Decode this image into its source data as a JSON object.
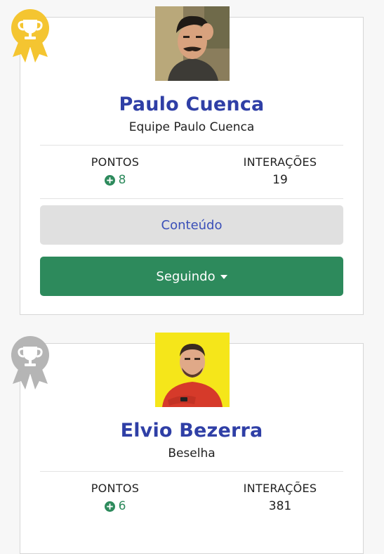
{
  "colors": {
    "name_blue": "#2f3fa6",
    "green": "#2d8a5c",
    "gold_badge": "#f4c531",
    "silver_badge": "#b5b5b5",
    "content_button_bg": "#e0e0e0"
  },
  "cards": [
    {
      "rank_badge": "gold-trophy-icon",
      "name": "Paulo Cuenca",
      "team": "Equipe Paulo Cuenca",
      "points_label": "PONTOS",
      "points_value": "8",
      "interactions_label": "INTERAÇÕES",
      "interactions_value": "19",
      "content_button": "Conteúdo",
      "follow_button": "Seguindo"
    },
    {
      "rank_badge": "silver-trophy-icon",
      "name": "Elvio Bezerra",
      "team": "Beselha",
      "points_label": "PONTOS",
      "points_value": "6",
      "interactions_label": "INTERAÇÕES",
      "interactions_value": "381"
    }
  ]
}
